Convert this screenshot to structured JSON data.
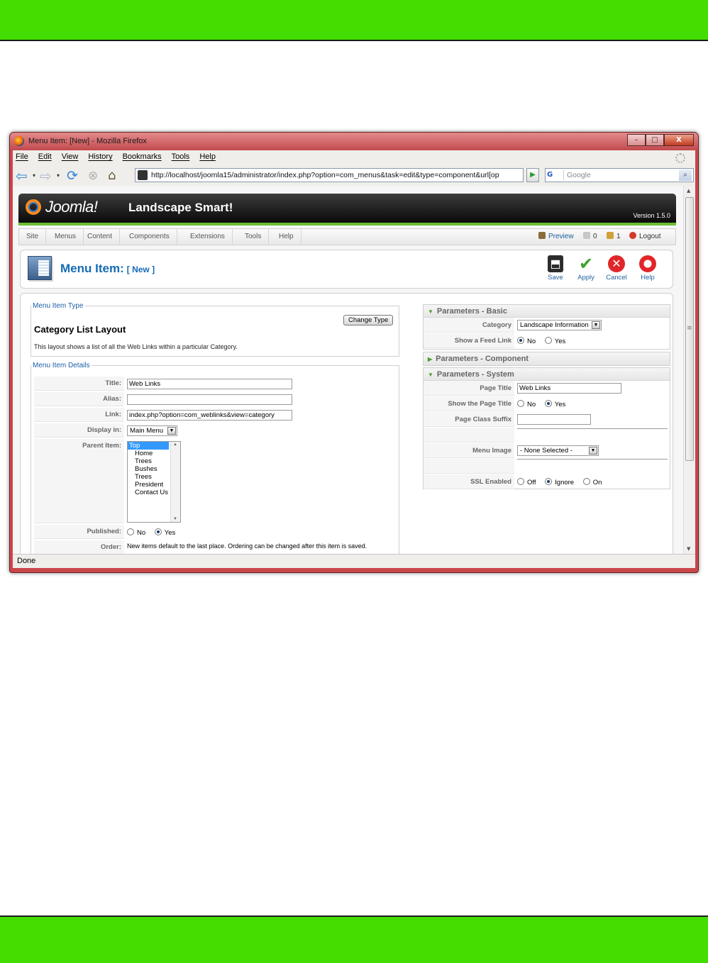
{
  "window": {
    "title": "Menu Item: [New] - Mozilla Firefox",
    "controls": {
      "minimize": "–",
      "maximize": "□",
      "close": "X"
    }
  },
  "browser": {
    "menu": [
      "File",
      "Edit",
      "View",
      "History",
      "Bookmarks",
      "Tools",
      "Help"
    ],
    "url": "http://localhost/joomla15/administrator/index.php?option=com_menus&task=edit&type=component&url[op",
    "search_placeholder": "Google",
    "search_engine_glyph": "G",
    "status": "Done"
  },
  "joomla": {
    "logo": "Joomla!",
    "site_name": "Landscape Smart!",
    "version": "Version 1.5.0",
    "menu": [
      "Site",
      "Menus",
      "Content",
      "Components",
      "Extensions",
      "Tools",
      "Help"
    ],
    "right": {
      "preview": "Preview",
      "messages": "0",
      "users": "1",
      "logout": "Logout"
    }
  },
  "toolbar": {
    "title": "Menu Item:",
    "subtitle": "[ New ]",
    "buttons": {
      "save": "Save",
      "apply": "Apply",
      "cancel": "Cancel",
      "help": "Help"
    }
  },
  "menu_item_type": {
    "legend": "Menu Item Type",
    "heading": "Category List Layout",
    "change_button": "Change Type",
    "description": "This layout shows a list of all the Web Links within a particular Category."
  },
  "details": {
    "legend": "Menu Item Details",
    "title_label": "Title:",
    "title_value": "Web Links",
    "alias_label": "Alias:",
    "alias_value": "",
    "link_label": "Link:",
    "link_value": "index.php?option=com_weblinks&view=category",
    "display_label": "Display in:",
    "display_value": "Main Menu",
    "parent_label": "Parent Item:",
    "parent_items": [
      "Top",
      "Home",
      "Trees",
      "Bushes",
      "Trees",
      "President",
      "Contact Us"
    ],
    "parent_selected": "Top",
    "published_label": "Published:",
    "published_no": "No",
    "published_yes": "Yes",
    "published_selected": "Yes",
    "order_label": "Order:",
    "order_value": "New items default to the last place. Ordering can be changed after this item is saved."
  },
  "params_basic": {
    "title": "Parameters - Basic",
    "category_label": "Category",
    "category_value": "Landscape Information",
    "feed_label": "Show a Feed Link",
    "feed_no": "No",
    "feed_yes": "Yes",
    "feed_selected": "No"
  },
  "params_component": {
    "title": "Parameters - Component"
  },
  "params_system": {
    "title": "Parameters - System",
    "page_title_label": "Page Title",
    "page_title_value": "Web Links",
    "show_title_label": "Show the Page Title",
    "show_title_no": "No",
    "show_title_yes": "Yes",
    "show_title_selected": "Yes",
    "suffix_label": "Page Class Suffix",
    "suffix_value": "",
    "image_label": "Menu Image",
    "image_value": "- None Selected -",
    "ssl_label": "SSL Enabled",
    "ssl_off": "Off",
    "ssl_ignore": "Ignore",
    "ssl_on": "On",
    "ssl_selected": "Ignore"
  },
  "colors": {
    "band_green": "#44dd00",
    "title_blue": "#146bb4",
    "window_red": "#c9474a"
  }
}
